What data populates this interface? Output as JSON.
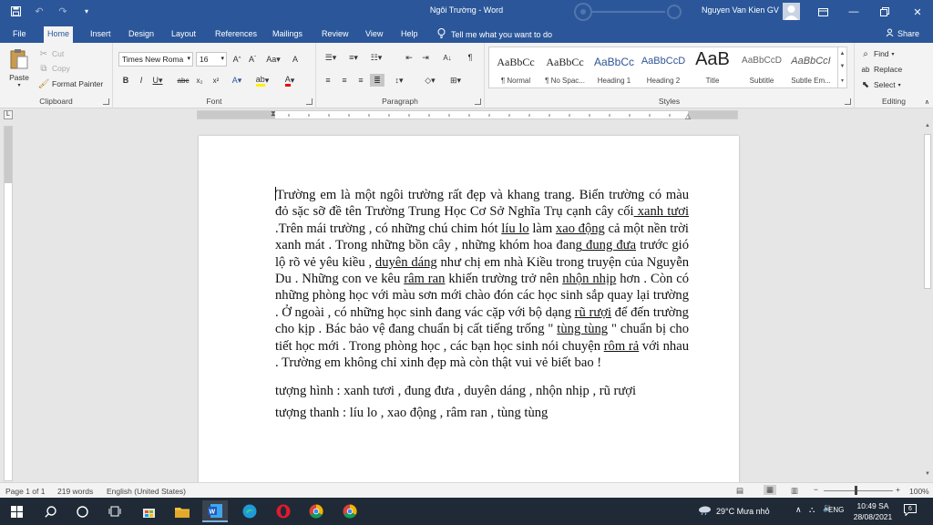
{
  "titlebar": {
    "doc_title": "Ngôi Trường - Word",
    "user_name": "Nguyen Van Kien GV"
  },
  "tabs": [
    "File",
    "Home",
    "Insert",
    "Design",
    "Layout",
    "References",
    "Mailings",
    "Review",
    "View",
    "Help"
  ],
  "active_tab": "Home",
  "tell_me": "Tell me what you want to do",
  "share": "Share",
  "clipboard": {
    "paste": "Paste",
    "cut": "Cut",
    "copy": "Copy",
    "format_painter": "Format Painter",
    "label": "Clipboard"
  },
  "font": {
    "name": "Times New Roma",
    "size": "16",
    "label": "Font"
  },
  "paragraph": {
    "label": "Paragraph"
  },
  "styles": {
    "label": "Styles",
    "items": [
      {
        "sample": "AaBbCc",
        "name": "¶ Normal"
      },
      {
        "sample": "AaBbCc",
        "name": "¶ No Spac..."
      },
      {
        "sample": "AaBbCc",
        "name": "Heading 1"
      },
      {
        "sample": "AaBbCcD",
        "name": "Heading 2"
      },
      {
        "sample": "AaB",
        "name": "Title"
      },
      {
        "sample": "AaBbCcD",
        "name": "Subtitle"
      },
      {
        "sample": "AaBbCcI",
        "name": "Subtle Em..."
      }
    ]
  },
  "editing": {
    "find": "Find",
    "replace": "Replace",
    "select": "Select",
    "label": "Editing"
  },
  "document": {
    "paragraph": [
      {
        "t": "Trường em là một ngôi trường rất đẹp và khang trang. Biển trường có màu đỏ sặc sỡ đề tên Trường Trung Học Cơ Sở Nghĩa Trụ cạnh cây cối",
        "u": false
      },
      {
        "t": " xanh tươi",
        "u": true
      },
      {
        "t": " .Trên mái trường , có những chú chim hót ",
        "u": false
      },
      {
        "t": "líu lo",
        "u": true
      },
      {
        "t": " làm ",
        "u": false
      },
      {
        "t": "xao động",
        "u": true
      },
      {
        "t": " cả một nền trời xanh mát . Trong những bồn cây , những khóm hoa đang",
        "u": false
      },
      {
        "t": " đung đưa",
        "u": true
      },
      {
        "t": " trước gió lộ rõ vẻ yêu kiều , ",
        "u": false
      },
      {
        "t": "duyên dáng",
        "u": true
      },
      {
        "t": " như chị em nhà Kiều trong truyện của Nguyễn Du . Những con ve kêu ",
        "u": false
      },
      {
        "t": "râm ran",
        "u": true
      },
      {
        "t": " khiến trường trở nên ",
        "u": false
      },
      {
        "t": "nhộn nhịp",
        "u": true
      },
      {
        "t": " hơn . Còn có những phòng học với màu sơn mới chào đón các học sinh sắp quay lại trường . Ở ngoài , có những học sinh đang vác cặp với bộ dạng ",
        "u": false
      },
      {
        "t": "rũ rượi",
        "u": true
      },
      {
        "t": " để đến trường cho kịp . Bác bảo vệ đang chuẩn bị cất tiếng trống \" ",
        "u": false
      },
      {
        "t": "tùng tùng",
        "u": true
      },
      {
        "t": " \" chuẩn bị cho tiết học mới . Trong phòng học , các bạn học sinh nói chuyện ",
        "u": false
      },
      {
        "t": "rôm rả",
        "u": true
      },
      {
        "t": " với nhau . Trường em không chỉ xinh đẹp mà còn thật vui vẻ biết bao !",
        "u": false
      }
    ],
    "summary_1": "tượng hình : xanh tươi , đung đưa , duyên dáng , nhộn nhịp , rũ rượi",
    "summary_2": "tượng thanh : líu lo , xao động , râm ran , tùng tùng"
  },
  "statusbar": {
    "page": "Page 1 of 1",
    "words": "219 words",
    "language": "English (United States)",
    "zoom": "100%"
  },
  "taskbar": {
    "weather": "29°C  Mưa nhỏ",
    "lang": "ENG",
    "time": "10:49 SA",
    "date": "28/08/2021",
    "notifications": "6"
  }
}
